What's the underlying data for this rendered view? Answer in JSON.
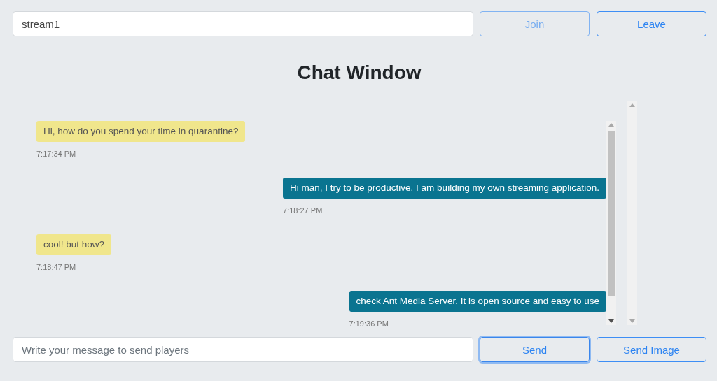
{
  "channel": {
    "value": "stream1"
  },
  "top_buttons": [
    {
      "label": "Join",
      "disabled": true,
      "focused": false
    },
    {
      "label": "Leave",
      "disabled": false,
      "focused": false
    }
  ],
  "title": "Chat Window",
  "messages": [
    {
      "kind": "received",
      "text": "Hi, how do you spend your time in quarantine?",
      "time": "7:17:34 PM"
    },
    {
      "kind": "sent",
      "text": "Hi man, I try to be productive. I am building my own streaming application.",
      "time": "7:18:27 PM"
    },
    {
      "kind": "received",
      "text": "cool! but how?",
      "time": "7:18:47 PM"
    },
    {
      "kind": "sent",
      "text": "check Ant Media Server. It is open source and easy to use",
      "time": "7:19:36 PM"
    }
  ],
  "composer": {
    "placeholder": "Write your message to send players"
  },
  "bottom_buttons": [
    {
      "label": "Send",
      "disabled": false,
      "focused": true
    },
    {
      "label": "Send Image",
      "disabled": false,
      "focused": false
    }
  ]
}
